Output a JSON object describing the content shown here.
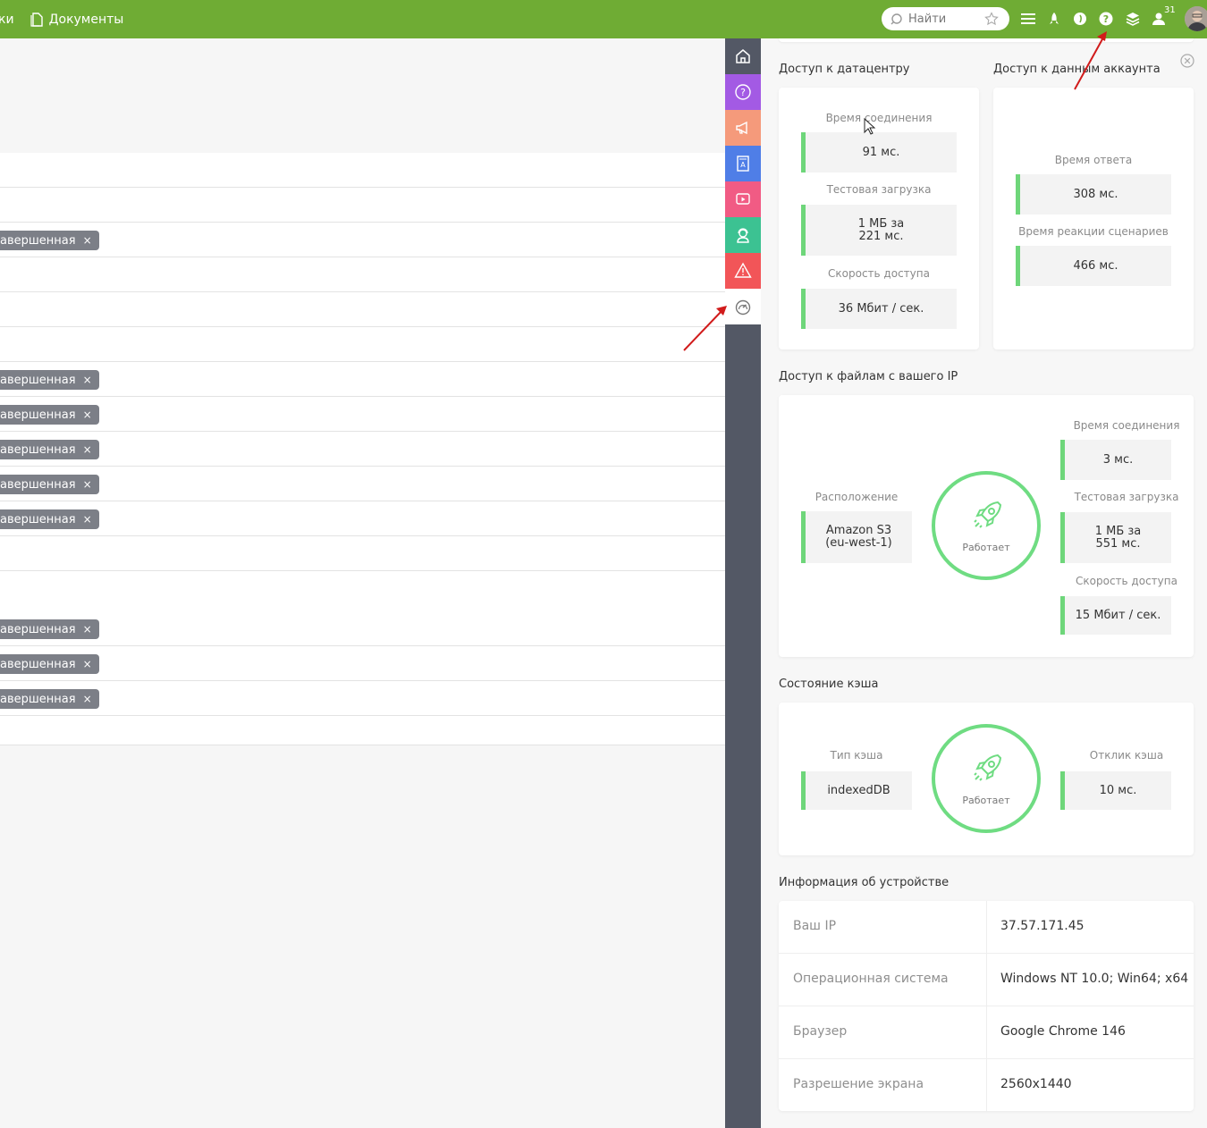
{
  "topbar": {
    "partial_left": "ки",
    "documents": "Документы",
    "search_placeholder": "Найти",
    "notif_count": "31"
  },
  "list": {
    "tag_label": "авершенная",
    "tag_close": "×"
  },
  "panel": {
    "datacenter": {
      "title": "Доступ к датацентру",
      "connect_label": "Время соединения",
      "connect_value": "91 мс.",
      "test_label": "Тестовая загрузка",
      "test_value_line1": "1 МБ за",
      "test_value_line2": "221 мс.",
      "speed_label": "Скорость доступа",
      "speed_value": "36 Мбит / сек."
    },
    "account": {
      "title": "Доступ к данным аккаунта",
      "response_label": "Время ответа",
      "response_value": "308 мс.",
      "scenario_label": "Время реакции сценариев",
      "scenario_value": "466 мс."
    },
    "files": {
      "title": "Доступ к файлам с вашего IP",
      "location_label": "Расположение",
      "location_line1": "Amazon S3",
      "location_line2": "(eu-west-1)",
      "status": "Работает",
      "connect_label": "Время соединения",
      "connect_value": "3 мс.",
      "test_label": "Тестовая загрузка",
      "test_value_line1": "1 МБ за",
      "test_value_line2": "551 мс.",
      "speed_label": "Скорость доступа",
      "speed_value": "15 Мбит / сек."
    },
    "cache": {
      "title": "Состояние кэша",
      "type_label": "Тип кэша",
      "type_value": "indexedDB",
      "status": "Работает",
      "response_label": "Отклик кэша",
      "response_value": "10 мс."
    },
    "device": {
      "title": "Информация об устройстве",
      "rows": [
        {
          "key": "Ваш IP",
          "value": "37.57.171.45"
        },
        {
          "key": "Операционная система",
          "value": "Windows NT 10.0; Win64; x64"
        },
        {
          "key": "Браузер",
          "value": "Google Chrome 146"
        },
        {
          "key": "Разрешение экрана",
          "value": "2560x1440"
        }
      ]
    }
  },
  "colors": {
    "topbar": "#6fac34",
    "accent_green": "#6ed67a",
    "sidebar": "#535865",
    "tag": "#7c7f87"
  },
  "sidebar_icons": [
    "home-icon",
    "help-icon",
    "megaphone-icon",
    "book-icon",
    "video-icon",
    "support-icon",
    "warning-icon",
    "speedometer-icon"
  ]
}
